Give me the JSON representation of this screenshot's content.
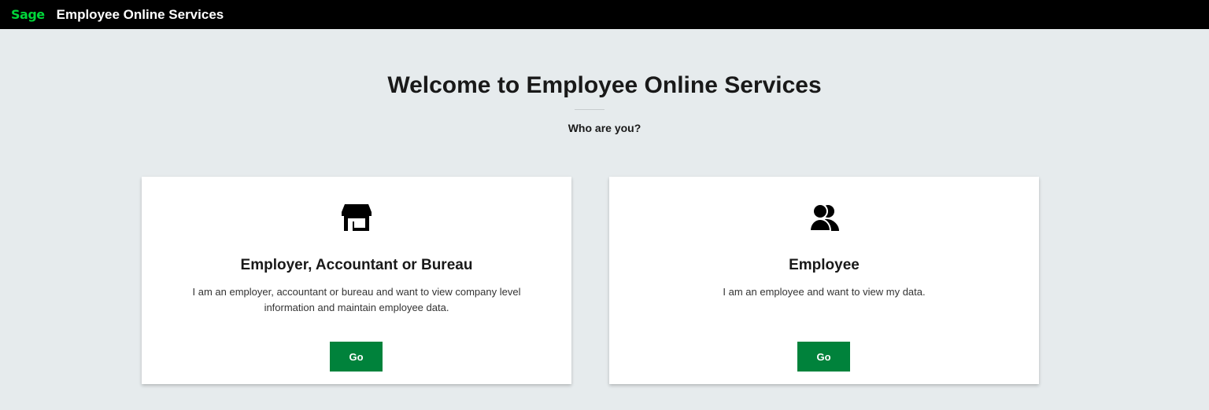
{
  "header": {
    "logo_text": "Sage",
    "app_title": "Employee Online Services",
    "logo_color": "#00d639",
    "background": "#000000"
  },
  "main": {
    "title": "Welcome to Employee Online Services",
    "subtitle": "Who are you?"
  },
  "cards": [
    {
      "icon": "store-icon",
      "title": "Employer, Accountant or Bureau",
      "description": "I am an employer, accountant or bureau and want to view company level information and maintain employee data.",
      "button_label": "Go"
    },
    {
      "icon": "users-icon",
      "title": "Employee",
      "description": "I am an employee and want to view my data.",
      "button_label": "Go"
    }
  ],
  "colors": {
    "accent": "#00823b",
    "page_background": "#e6ebed",
    "card_background": "#ffffff"
  }
}
